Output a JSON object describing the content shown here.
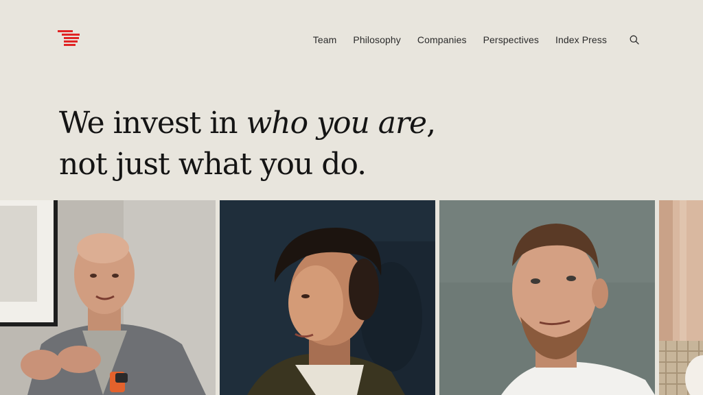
{
  "header": {
    "logo_alt": "Index Ventures logo",
    "nav": [
      {
        "label": "Team"
      },
      {
        "label": "Philosophy"
      },
      {
        "label": "Companies"
      },
      {
        "label": "Perspectives"
      },
      {
        "label": "Index Press"
      }
    ],
    "search_icon": "search-icon"
  },
  "hero": {
    "line1_prefix": "We invest in ",
    "line1_italic": "who you are",
    "line1_suffix": ",",
    "line2": "not just what you do."
  },
  "colors": {
    "background": "#e8e5dd",
    "accent": "#e02424",
    "text": "#141414"
  },
  "photos": [
    {
      "name": "portrait-1"
    },
    {
      "name": "portrait-2"
    },
    {
      "name": "portrait-3"
    },
    {
      "name": "portrait-4"
    }
  ]
}
